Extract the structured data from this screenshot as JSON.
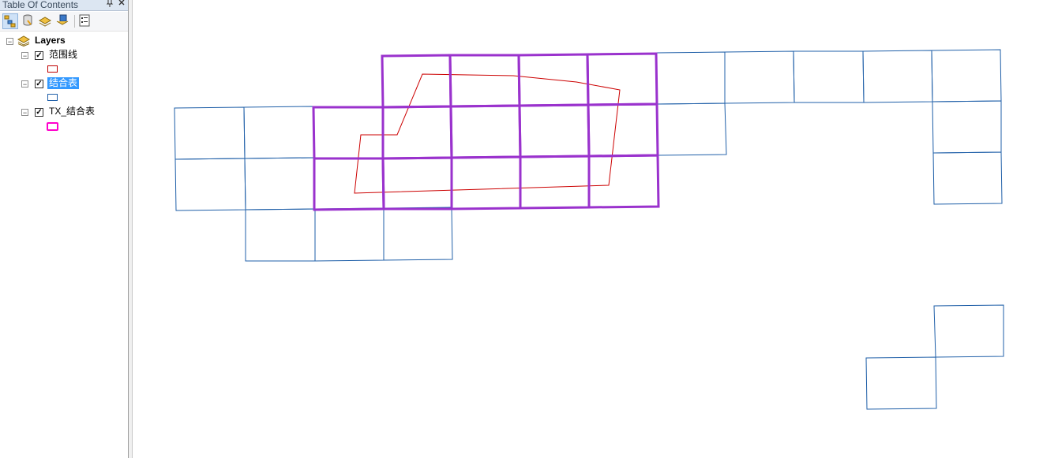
{
  "toc": {
    "title": "Table Of Contents",
    "pin_icon": "pin-icon",
    "close_icon": "close-icon",
    "toolbar": {
      "buttons": [
        "list-by-drawing-order-icon",
        "list-by-source-icon",
        "list-by-visibility-icon",
        "list-by-selection-icon",
        "options-icon"
      ]
    },
    "root": {
      "label": "Layers",
      "expanded": true,
      "icon": "layers-icon"
    },
    "layers": [
      {
        "label": "范围线",
        "checked": true,
        "symbol_color": "#c00000",
        "symbol_style": "outline-thin",
        "selected": false
      },
      {
        "label": "结合表",
        "checked": true,
        "symbol_color": "#1f5fa8",
        "symbol_style": "outline-thin",
        "selected": true
      },
      {
        "label": "TX_结合表",
        "checked": true,
        "symbol_color": "#ff00cc",
        "symbol_style": "outline-thick",
        "selected": false
      }
    ]
  },
  "map": {
    "layer_colors": {
      "fanweixian": "#cc0000",
      "jieheibiao": "#1f5fa8",
      "tx_jieheibiao": "#9a32cd"
    }
  }
}
